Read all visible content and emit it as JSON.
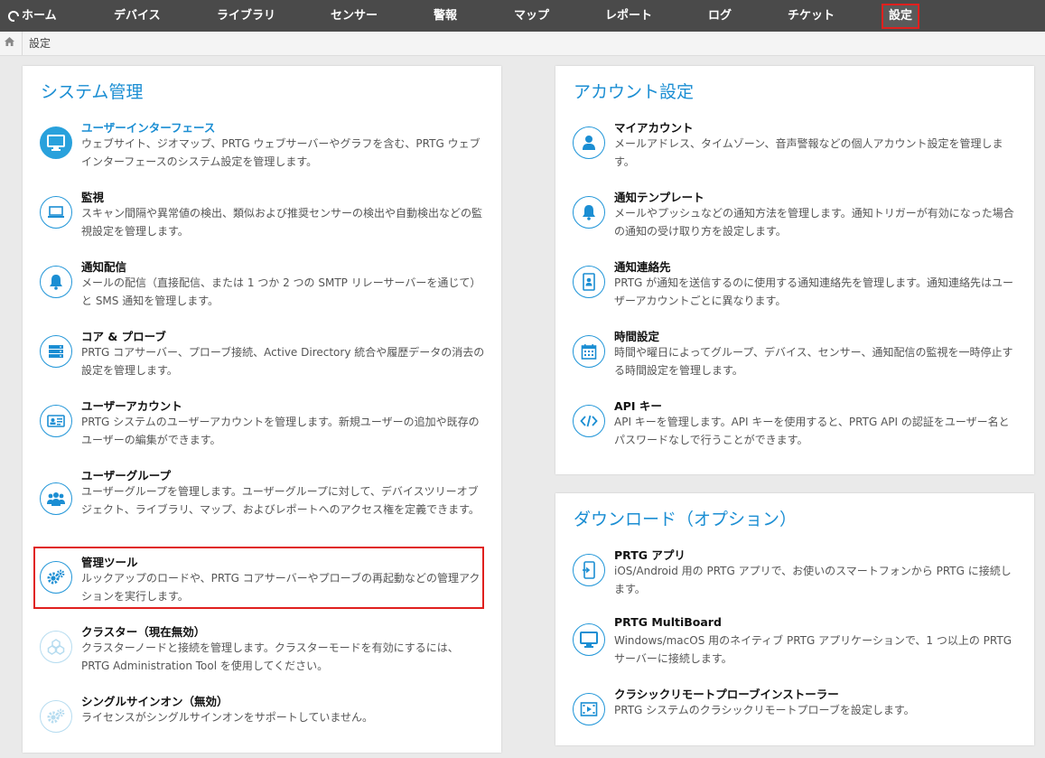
{
  "nav": {
    "home": "ホーム",
    "devices": "デバイス",
    "library": "ライブラリ",
    "sensors": "センサー",
    "alarms": "警報",
    "maps": "マップ",
    "reports": "レポート",
    "logs": "ログ",
    "tickets": "チケット",
    "setup": "設定"
  },
  "breadcrumb": {
    "current": "設定"
  },
  "system": {
    "title": "システム管理",
    "items": [
      {
        "icon": "monitor-icon",
        "title": "ユーザーインターフェース",
        "desc": "ウェブサイト、ジオマップ、PRTG ウェブサーバーやグラフを含む、PRTG ウェブインターフェースのシステム設定を管理します。"
      },
      {
        "icon": "laptop-icon",
        "title": "監視",
        "desc": "スキャン間隔や異常値の検出、類似および推奨センサーの検出や自動検出などの監視設定を管理します。"
      },
      {
        "icon": "bell-icon",
        "title": "通知配信",
        "desc": "メールの配信（直接配信、または 1 つか 2 つの SMTP リレーサーバーを通じて）と SMS 通知を管理します。"
      },
      {
        "icon": "server-icon",
        "title": "コア & プローブ",
        "desc": "PRTG コアサーバー、プローブ接続、Active Directory 統合や履歴データの消去の設定を管理します。"
      },
      {
        "icon": "id-card-icon",
        "title": "ユーザーアカウント",
        "desc": "PRTG システムのユーザーアカウントを管理します。新規ユーザーの追加や既存のユーザーの編集ができます。"
      },
      {
        "icon": "users-icon",
        "title": "ユーザーグループ",
        "desc": "ユーザーグループを管理します。ユーザーグループに対して、デバイスツリーオブジェクト、ライブラリ、マップ、およびレポートへのアクセス権を定義できます。"
      },
      {
        "icon": "gears-icon",
        "title": "管理ツール",
        "desc": "ルックアップのロードや、PRTG コアサーバーやプローブの再起動などの管理アクションを実行します。"
      },
      {
        "icon": "cluster-icon",
        "title": "クラスター（現在無効）",
        "desc": "クラスターノードと接続を管理します。クラスターモードを有効にするには、PRTG Administration Tool を使用してください。"
      },
      {
        "icon": "gears-icon",
        "title": "シングルサインオン（無効）",
        "desc": "ライセンスがシングルサインオンをサポートしていません。"
      }
    ]
  },
  "account": {
    "title": "アカウント設定",
    "items": [
      {
        "icon": "user-icon",
        "title": "マイアカウント",
        "desc": "メールアドレス、タイムゾーン、音声警報などの個人アカウント設定を管理します。"
      },
      {
        "icon": "bell-icon",
        "title": "通知テンプレート",
        "desc": "メールやプッシュなどの通知方法を管理します。通知トリガーが有効になった場合の通知の受け取り方を設定します。"
      },
      {
        "icon": "contact-book-icon",
        "title": "通知連絡先",
        "desc": "PRTG が通知を送信するのに使用する通知連絡先を管理します。通知連絡先はユーザーアカウントごとに異なります。"
      },
      {
        "icon": "calendar-icon",
        "title": "時間設定",
        "desc": "時間や曜日によってグループ、デバイス、センサー、通知配信の監視を一時停止する時間設定を管理します。"
      },
      {
        "icon": "code-icon",
        "title": "API キー",
        "desc": "API キーを管理します。API キーを使用すると、PRTG API の認証をユーザー名とパスワードなしで行うことができます。"
      }
    ]
  },
  "downloads": {
    "title": "ダウンロード（オプション）",
    "items": [
      {
        "icon": "mobile-app-icon",
        "title": "PRTG アプリ",
        "desc": "iOS/Android 用の PRTG アプリで、お使いのスマートフォンから PRTG に接続します。"
      },
      {
        "icon": "monitor-icon",
        "title": "PRTG MultiBoard",
        "desc": "Windows/macOS 用のネイティブ PRTG アプリケーションで、1 つ以上の PRTG サーバーに接続します。"
      },
      {
        "icon": "installer-icon",
        "title": "クラシックリモートプローブインストーラー",
        "desc": "PRTG システムのクラシックリモートプローブを設定します。"
      }
    ]
  },
  "colors": {
    "accent": "#1b8ed3",
    "nav": "#4a4a4a",
    "highlight": "#e0201e"
  }
}
